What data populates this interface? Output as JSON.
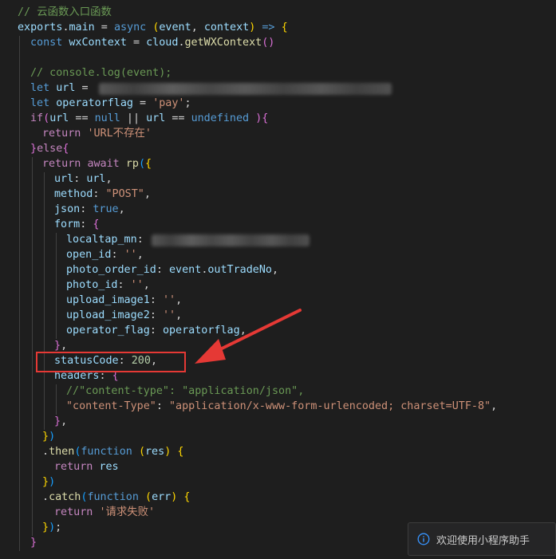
{
  "code": {
    "l1": {
      "comment": "// 云函数入口函数"
    },
    "l2": {
      "exports": "exports",
      "dot": ".",
      "main": "main",
      "eq": " = ",
      "async": "async",
      "sp": " ",
      "open": "(",
      "p1": "event",
      "comma": ", ",
      "p2": "context",
      "close": ")",
      "arrow": " => ",
      "brace": "{"
    },
    "l3": {
      "const": "const",
      "sp": " ",
      "var": "wxContext",
      "eq": " = ",
      "obj": "cloud",
      "dot": ".",
      "func": "getWXContext",
      "parens": "()"
    },
    "l5": {
      "comment": "// console.log(event);"
    },
    "l6": {
      "let": "let",
      "sp": " ",
      "var": "url",
      "eq": " ="
    },
    "l7": {
      "let": "let",
      "sp": " ",
      "var": "operatorflag",
      "eq": " = ",
      "str": "'pay'",
      "semi": ";"
    },
    "l8": {
      "if": "if",
      "open": "(",
      "v1": "url",
      "eq1": " == ",
      "null": "null",
      "or": " || ",
      "v2": "url",
      "eq2": " == ",
      "undef": "undefined",
      "sp": " ",
      "close": ")",
      "brace": "{"
    },
    "l9": {
      "return": "return",
      "sp": " ",
      "str": "'URL不存在'"
    },
    "l10": {
      "brace": "}",
      "else": "else",
      "open": "{"
    },
    "l11": {
      "return": "return",
      "sp": " ",
      "await": "await",
      "sp2": " ",
      "func": "rp",
      "open": "(",
      "brace": "{"
    },
    "l12": {
      "key": "url",
      "colon": ": ",
      "val": "url",
      "comma": ","
    },
    "l13": {
      "key": "method",
      "colon": ": ",
      "val": "\"POST\"",
      "comma": ","
    },
    "l14": {
      "key": "json",
      "colon": ": ",
      "val": "true",
      "comma": ","
    },
    "l15": {
      "key": "form",
      "colon": ": ",
      "brace": "{"
    },
    "l16": {
      "key": "localtap_mn",
      "colon": ":"
    },
    "l17": {
      "key": "open_id",
      "colon": ": ",
      "val": "''",
      "comma": ","
    },
    "l18": {
      "key": "photo_order_id",
      "colon": ": ",
      "obj": "event",
      "dot": ".",
      "prop": "outTradeNo",
      "comma": ","
    },
    "l19": {
      "key": "photo_id",
      "colon": ": ",
      "val": "''",
      "comma": ","
    },
    "l20": {
      "key": "upload_image1",
      "colon": ": ",
      "val": "''",
      "comma": ","
    },
    "l21": {
      "key": "upload_image2",
      "colon": ": ",
      "val": "''",
      "comma": ","
    },
    "l22": {
      "key": "operator_flag",
      "colon": ": ",
      "val": "operatorflag",
      "comma": ","
    },
    "l23": {
      "brace": "}",
      "comma": ","
    },
    "l24": {
      "key": "statusCode",
      "colon": ": ",
      "val": "200",
      "comma": ","
    },
    "l25": {
      "key": "headers",
      "colon": ": ",
      "brace": "{"
    },
    "l26": {
      "comment": "//\"content-type\": \"application/json\","
    },
    "l27": {
      "key": "\"content-Type\"",
      "colon": ": ",
      "val": "\"application/x-www-form-urlencoded; charset=UTF-8\"",
      "comma": ","
    },
    "l28": {
      "brace": "}",
      "comma": ","
    },
    "l29": {
      "brace": "}",
      "paren": ")"
    },
    "l30": {
      "dot": ".",
      "func": "then",
      "open": "(",
      "kw": "function",
      "sp": " ",
      "popen": "(",
      "param": "res",
      "pclose": ")",
      "sp2": " ",
      "brace": "{"
    },
    "l31": {
      "return": "return",
      "sp": " ",
      "var": "res"
    },
    "l32": {
      "brace": "}",
      "paren": ")"
    },
    "l33": {
      "dot": ".",
      "func": "catch",
      "open": "(",
      "kw": "function",
      "sp": " ",
      "popen": "(",
      "param": "err",
      "pclose": ")",
      "sp2": " ",
      "brace": "{"
    },
    "l34": {
      "return": "return",
      "sp": " ",
      "str": "'请求失败'"
    },
    "l35": {
      "brace": "}",
      "paren": ")",
      "semi": ";"
    },
    "l36": {
      "brace": "}"
    }
  },
  "toast": {
    "icon": "info-icon",
    "message": "欢迎使用小程序助手"
  },
  "colors": {
    "annotation": "#e53935",
    "background": "#1e1e1e"
  }
}
